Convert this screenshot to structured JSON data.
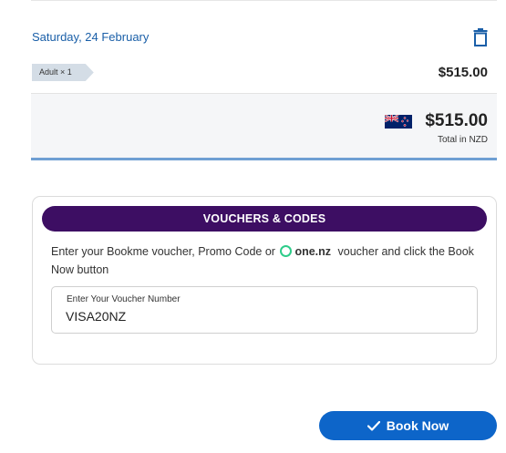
{
  "booking": {
    "date": "Saturday, 24 February",
    "delete_icon": "trash-icon",
    "passenger_tag": "Adult × 1",
    "line_price": "$515.00",
    "total": {
      "flag_icon": "nz-flag-icon",
      "amount": "$515.00",
      "label": "Total in NZD"
    }
  },
  "voucher": {
    "header": "VOUCHERS & CODES",
    "description_before": "Enter your Bookme voucher, Promo Code or",
    "onenz_logo_text": "one.nz",
    "description_after": "voucher and click the Book Now button",
    "field_label": "Enter Your Voucher Number",
    "field_value": "VISA20NZ"
  },
  "book_button": {
    "label": "Book Now",
    "icon": "check-icon"
  },
  "colors": {
    "accent_blue": "#0d65c9",
    "voucher_header_purple": "#3d0e63",
    "date_blue": "#1a5fa8",
    "onenz_green": "#2ecc8a"
  }
}
